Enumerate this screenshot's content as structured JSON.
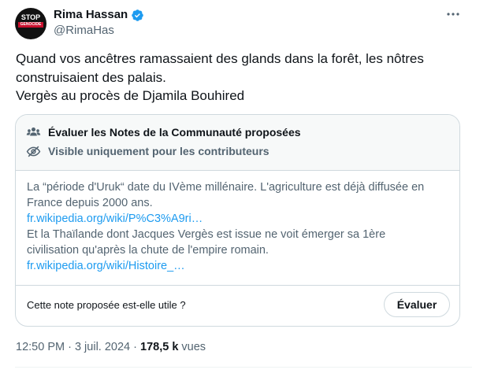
{
  "author": {
    "name": "Rima Hassan",
    "handle": "@RimaHas",
    "avatar_text_top": "STOP",
    "avatar_text_bottom": "GENOCIDE",
    "verified_color": "#1d9bf0"
  },
  "tweet": {
    "lines": [
      "Quand vos ancêtres ramassaient des glands dans la forêt, les nôtres",
      "construisaient des palais.",
      "Vergès au procès de Djamila Bouhired"
    ]
  },
  "note": {
    "header_title": "Évaluer les Notes de la Communauté proposées",
    "header_subtitle": "Visible uniquement pour les contributeurs",
    "body_line1": "La “période d'Uruk“ date du IVème millénaire. L'agriculture est déjà diffusée en",
    "body_line2": "France depuis 2000 ans.",
    "link1": "fr.wikipedia.org/wiki/P%C3%A9ri…",
    "body_line3": "Et la Thaïlande dont Jacques Vergès est issue ne voit émerger sa 1ère",
    "body_line4": "civilisation qu'après la chute de l'empire romain.",
    "link2": "fr.wikipedia.org/wiki/Histoire_…",
    "question": "Cette note proposée est-elle utile ?",
    "evaluate_label": "Évaluer"
  },
  "meta": {
    "time": "12:50 PM",
    "separator1": " · ",
    "date": "3 juil. 2024",
    "separator2": " · ",
    "views_count": "178,5 k",
    "views_label": " vues"
  },
  "colors": {
    "text": "#0f1419",
    "muted": "#536471",
    "link": "#1d9bf0",
    "border": "#cfd9de"
  }
}
